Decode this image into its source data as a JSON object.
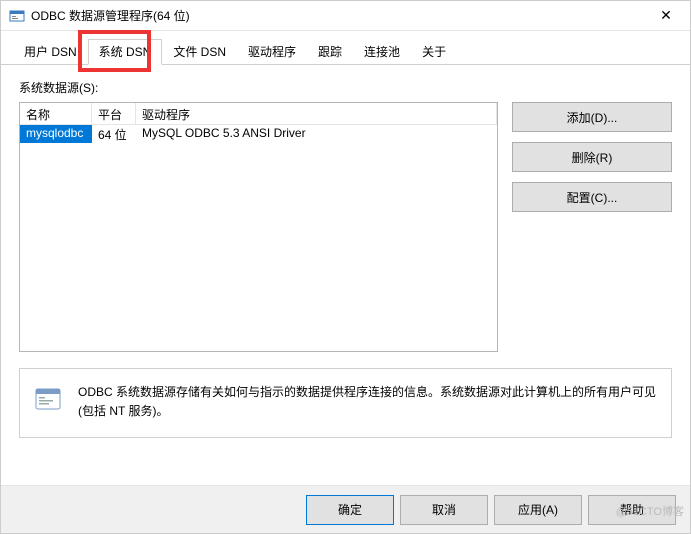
{
  "window": {
    "title": "ODBC 数据源管理程序(64 位)",
    "close_symbol": "✕"
  },
  "tabs": [
    {
      "label": "用户 DSN"
    },
    {
      "label": "系统 DSN"
    },
    {
      "label": "文件 DSN"
    },
    {
      "label": "驱动程序"
    },
    {
      "label": "跟踪"
    },
    {
      "label": "连接池"
    },
    {
      "label": "关于"
    }
  ],
  "active_tab_index": 1,
  "list_label": "系统数据源(S):",
  "columns": {
    "name": "名称",
    "platform": "平台",
    "driver": "驱动程序"
  },
  "rows": [
    {
      "name": "mysqlodbc",
      "platform": "64 位",
      "driver": "MySQL ODBC 5.3 ANSI Driver",
      "selected": true
    }
  ],
  "side_buttons": {
    "add": "添加(D)...",
    "remove": "删除(R)",
    "configure": "配置(C)..."
  },
  "info_text": "ODBC 系统数据源存储有关如何与指示的数据提供程序连接的信息。系统数据源对此计算机上的所有用户可见(包括 NT 服务)。",
  "bottom_buttons": {
    "ok": "确定",
    "cancel": "取消",
    "apply": "应用(A)",
    "help": "帮助"
  },
  "watermark": "@51CTO博客"
}
